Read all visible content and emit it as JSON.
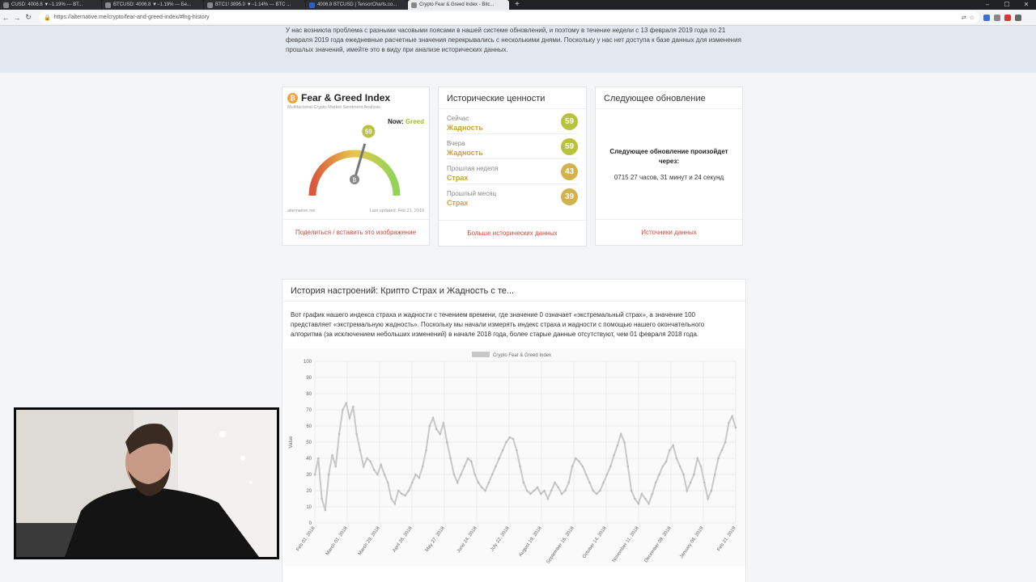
{
  "browser": {
    "tabs": [
      {
        "title": "CUSD: 4006.8 ▼−1.19% — BT...",
        "active": false
      },
      {
        "title": "BTCUSD: 4006.8 ▼−1.19% — Бе...",
        "active": false
      },
      {
        "title": "BTC1! 3895.0 ▼−1.14% — BTC ...",
        "active": false
      },
      {
        "title": "4006.8 BTCUSD | TensorCharts.co...",
        "active": false
      },
      {
        "title": "Crypto Fear & Greed Index - Bitc...",
        "active": true
      }
    ],
    "url": "https://alternative.me/crypto/fear-and-greed-index/#fng-history"
  },
  "notice": {
    "text": "У нас возникла проблема с разными часовыми поясами в нашей системе обновлений, и поэтому в течение недели с 13 февраля 2019 года по 21 февраля 2019 года ежедневные расчетные значения перекрывались с несколькими днями. Поскольку у нас нет доступа к базе данных для изменения прошлых значений, имейте это в виду при анализе исторических данных."
  },
  "fng": {
    "title": "Fear & Greed Index",
    "subtitle": "Multifactorial Crypto Market Sentiment Analysis",
    "now_label": "Now:",
    "now_value": "Greed",
    "value": 59,
    "site": "alternative.me",
    "last_updated": "Last updated: Feb 21, 2019",
    "share_link": "Поделиться / вставить это изображение"
  },
  "historical": {
    "title": "Исторические ценности",
    "rows": [
      {
        "label": "Сейчас",
        "value": "Жадность",
        "score": "59",
        "color": "#b8c23a"
      },
      {
        "label": "Вчера",
        "value": "Жадность",
        "score": "59",
        "color": "#b8c23a"
      },
      {
        "label": "Прошлая неделя",
        "value": "Страх",
        "score": "43",
        "color": "#d2b24a"
      },
      {
        "label": "Прошлый месяц",
        "value": "Страх",
        "score": "39",
        "color": "#d2b24a"
      }
    ],
    "more_link": "Больше исторических данных"
  },
  "next_update": {
    "title": "Следующее обновление",
    "text": "Следующее обновление произойдет через:",
    "time": "0715 27 часов, 31 минут и 24 секунд",
    "sources_link": "Источники данных"
  },
  "history": {
    "title": "История настроений: Крипто Страх и Жадность с те...",
    "text": "Вот график нашего индекса страха и жадности с течением времени, где значение 0 означает «экстремальный страх», а значение 100 представляет «экстремальную жадность». Поскольку мы начали измерять индекс страха и жадности с помощью нашего окончательного алгоритма (за исключением небольших изменений) в начале 2018 года, более старые данные отсутствуют, чем 01 февраля 2018 года."
  },
  "chart_data": {
    "type": "line",
    "legend": "Crypto Fear & Greed Index",
    "ylabel": "Value",
    "ylim": [
      0,
      100
    ],
    "yticks": [
      0,
      10,
      20,
      30,
      40,
      50,
      60,
      70,
      80,
      90,
      100
    ],
    "xticks": [
      "Feb 01, 2018",
      "March 01, 2018",
      "March 29, 2018",
      "April 26, 2018",
      "May 27, 2018",
      "June 24, 2018",
      "July 22, 2018",
      "August 19, 2018",
      "September 16, 2018",
      "October 14, 2018",
      "November 11, 2018",
      "December 09, 2018",
      "January 06, 2019",
      "Feb 21, 2019"
    ],
    "values": [
      30,
      40,
      15,
      8,
      30,
      42,
      35,
      55,
      70,
      74,
      65,
      72,
      55,
      45,
      35,
      40,
      38,
      33,
      30,
      36,
      30,
      25,
      15,
      12,
      20,
      18,
      17,
      20,
      25,
      30,
      28,
      35,
      45,
      60,
      65,
      58,
      55,
      62,
      50,
      40,
      30,
      25,
      30,
      35,
      40,
      38,
      30,
      25,
      22,
      20,
      25,
      30,
      35,
      40,
      45,
      50,
      53,
      52,
      45,
      35,
      25,
      20,
      18,
      20,
      22,
      18,
      20,
      15,
      20,
      25,
      22,
      18,
      20,
      25,
      35,
      40,
      38,
      35,
      30,
      25,
      20,
      18,
      20,
      25,
      30,
      35,
      42,
      48,
      55,
      50,
      35,
      20,
      15,
      12,
      18,
      15,
      12,
      18,
      25,
      30,
      35,
      38,
      45,
      48,
      40,
      35,
      30,
      20,
      25,
      30,
      40,
      35,
      25,
      15,
      20,
      30,
      40,
      45,
      50,
      62,
      66,
      59
    ],
    "line_color": "#c8c8c8"
  },
  "colors": {
    "link": "#d0483a",
    "greed": "#9bbd2c",
    "fear": "#c9a23a",
    "notice_bg": "#e3e8ef"
  }
}
